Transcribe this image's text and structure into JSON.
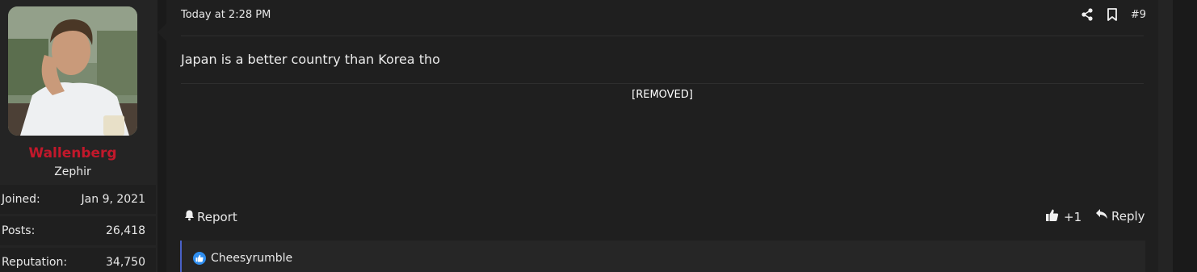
{
  "user": {
    "name": "Wallenberg",
    "title": "Zephir",
    "name_color": "#c2182b",
    "stats": [
      {
        "label": "Joined:",
        "value": "Jan 9, 2021"
      },
      {
        "label": "Posts:",
        "value": "26,418"
      },
      {
        "label": "Reputation:",
        "value": "34,750"
      }
    ]
  },
  "post": {
    "timestamp": "Today at 2:28 PM",
    "number": "#9",
    "body": "Japan is a better country than Korea tho",
    "signature": "[REMOVED]",
    "actions": {
      "report": "Report",
      "like_count": "+1",
      "reply": "Reply"
    },
    "reactions": {
      "icon": "like-icon",
      "users": "Cheesyrumble",
      "accent": "#4a62c8"
    }
  },
  "icons": {
    "share": "share-icon",
    "bookmark": "bookmark-icon",
    "bell": "bell-icon",
    "thumbs_up": "thumbs-up-icon",
    "reply": "reply-icon"
  }
}
